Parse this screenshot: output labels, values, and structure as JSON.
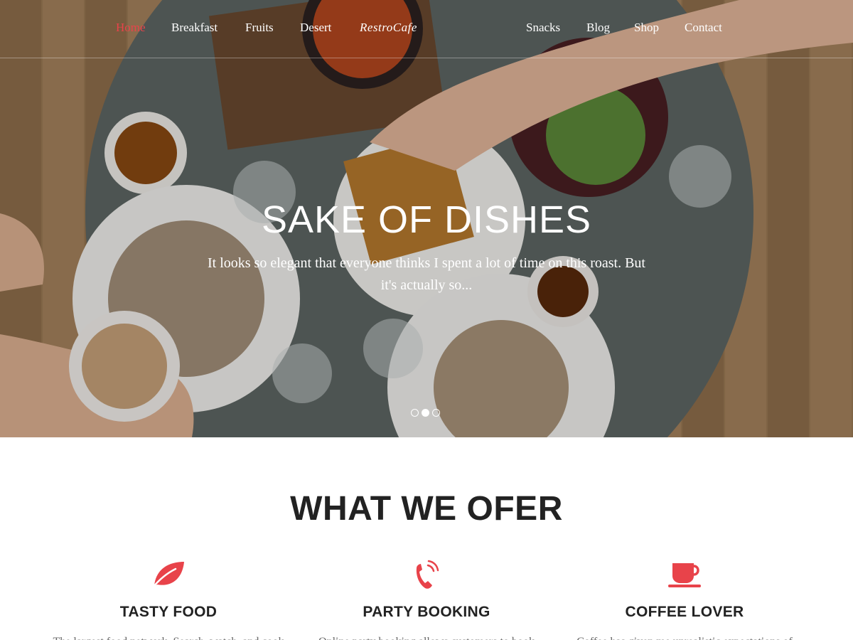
{
  "brand": {
    "logo": "RestroCafe",
    "accent": "#e8434a"
  },
  "nav": {
    "items": [
      {
        "label": "Home",
        "active": true
      },
      {
        "label": "Breakfast",
        "active": false
      },
      {
        "label": "Fruits",
        "active": false
      },
      {
        "label": "Desert",
        "active": false
      },
      {
        "label": "Snacks",
        "active": false
      },
      {
        "label": "Blog",
        "active": false
      },
      {
        "label": "Shop",
        "active": false
      },
      {
        "label": "Contact",
        "active": false
      }
    ]
  },
  "hero": {
    "title": "SAKE OF DISHES",
    "text": "It looks so elegant that everyone thinks I spent a lot of time on this roast. But it's actually so...",
    "slides": 3,
    "active_slide": 2
  },
  "offer": {
    "title": "WHAT WE OFER",
    "features": [
      {
        "icon": "leaf-icon",
        "title": "TASTY FOOD",
        "text": "The largest food network. Search, watch, and cook"
      },
      {
        "icon": "phone-ringing-icon",
        "title": "PARTY BOOKING",
        "text": "Online party booking allows customers to book"
      },
      {
        "icon": "coffee-cup-icon",
        "title": "COFFEE LOVER",
        "text": "Coffee has given me unrealistic expectations of"
      }
    ]
  }
}
